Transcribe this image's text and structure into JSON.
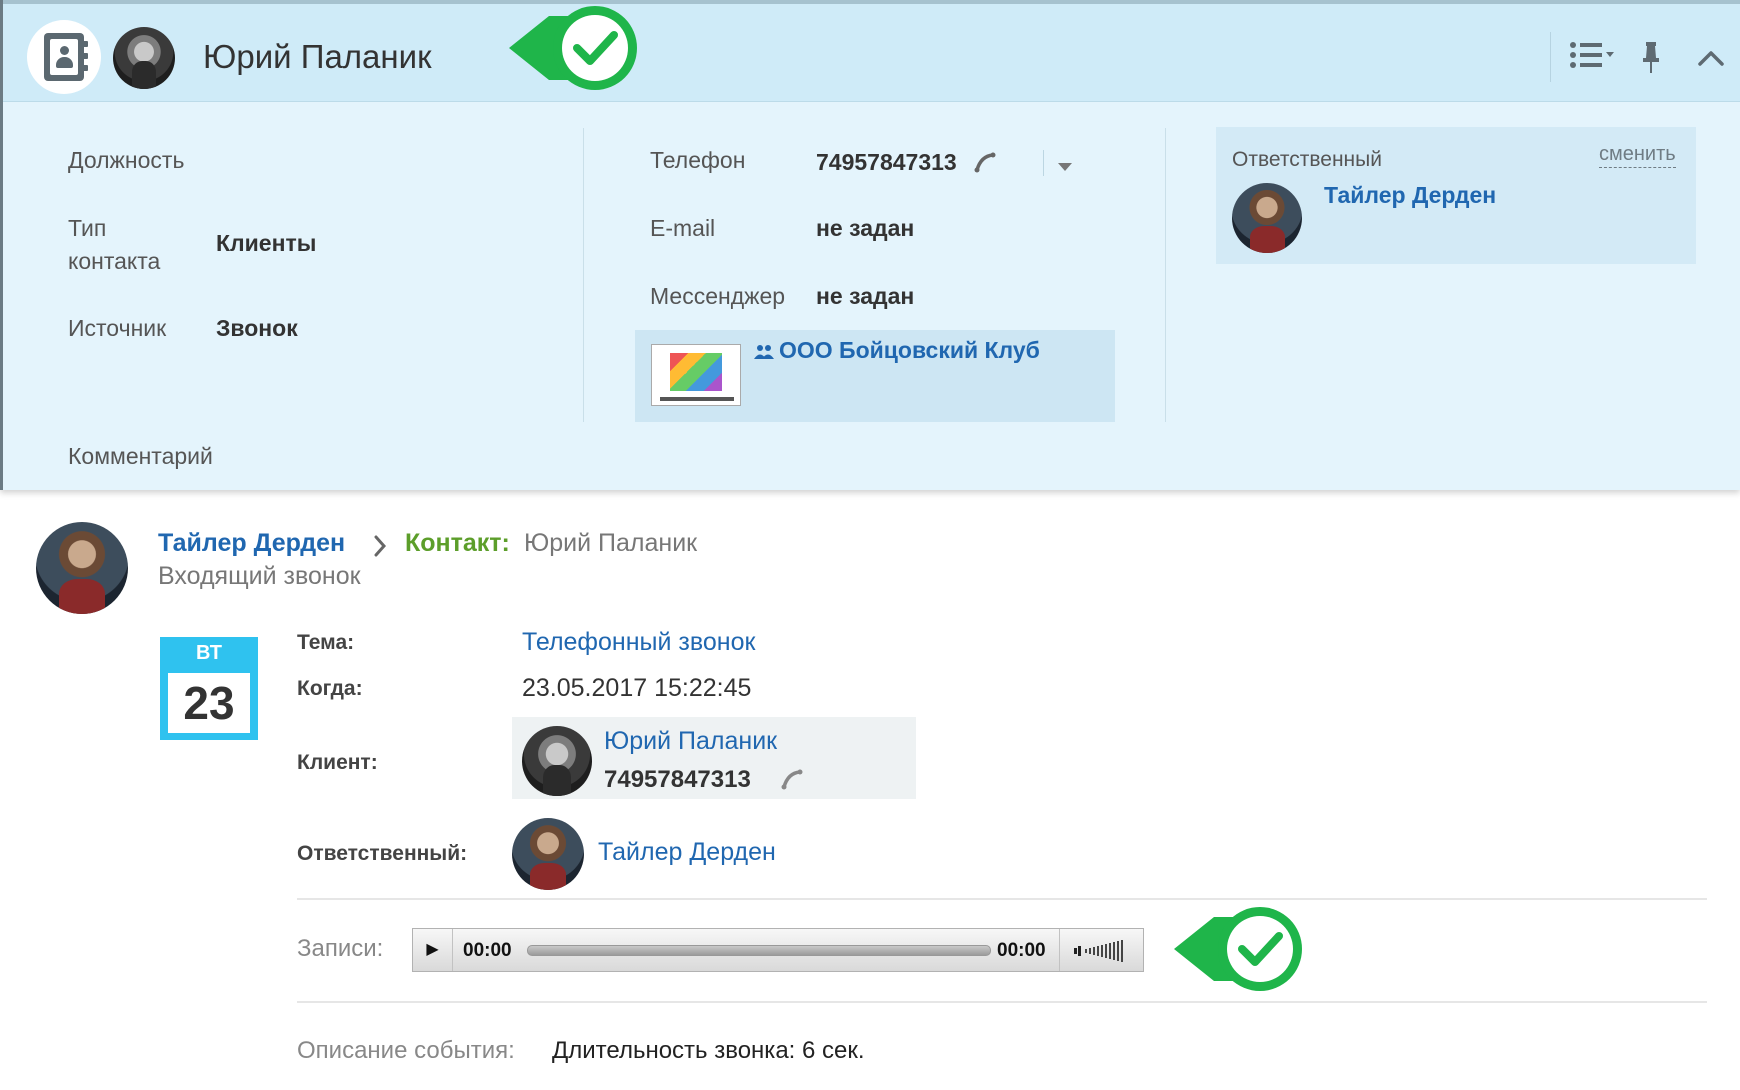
{
  "header": {
    "contact_name": "Юрий Паланик",
    "icons": [
      "contact-book-icon",
      "check-badge-icon",
      "list-menu-icon",
      "pin-icon",
      "collapse-chevron-icon"
    ]
  },
  "fields_left": {
    "position_label": "Должность",
    "contact_type_label_1": "Тип",
    "contact_type_label_2": "контакта",
    "contact_type_value": "Клиенты",
    "source_label": "Источник",
    "source_value": "Звонок",
    "comment_label": "Комментарий"
  },
  "fields_mid": {
    "phone_label": "Телефон",
    "phone_value": "74957847313",
    "email_label": "E-mail",
    "email_value": "не задан",
    "messenger_label": "Мессенджер",
    "messenger_value": "не задан",
    "company_name": "ООО Бойцовский Клуб"
  },
  "responsible": {
    "label": "Ответственный",
    "change_link": "сменить",
    "name": "Тайлер Дерден"
  },
  "activity": {
    "author": "Тайлер Дерден",
    "contact_label": "Контакт:",
    "contact_name": "Юрий Паланик",
    "type": "Входящий звонок",
    "calendar_dow": "ВТ",
    "calendar_day": "23",
    "subject_label": "Тема:",
    "subject_value": "Телефонный звонок",
    "when_label": "Когда:",
    "when_value": "23.05.2017 15:22:45",
    "client_label": "Клиент:",
    "client_name": "Юрий Паланик",
    "client_phone": "74957847313",
    "responsible_label": "Ответственный:",
    "responsible_name": "Тайлер Дерден",
    "records_label": "Записи:",
    "player_current": "00:00",
    "player_total": "00:00",
    "player_progress": 0,
    "description_label": "Описание события:",
    "description_value": "Длительность звонка: 6 сек."
  },
  "colors": {
    "header_bg": "#cfebf8",
    "card_bg": "#e4f4fc",
    "link": "#2067b0",
    "contact_label_green": "#5c9e2a",
    "badge_green": "#1fb54a",
    "calendar_blue": "#2fc2ef"
  }
}
